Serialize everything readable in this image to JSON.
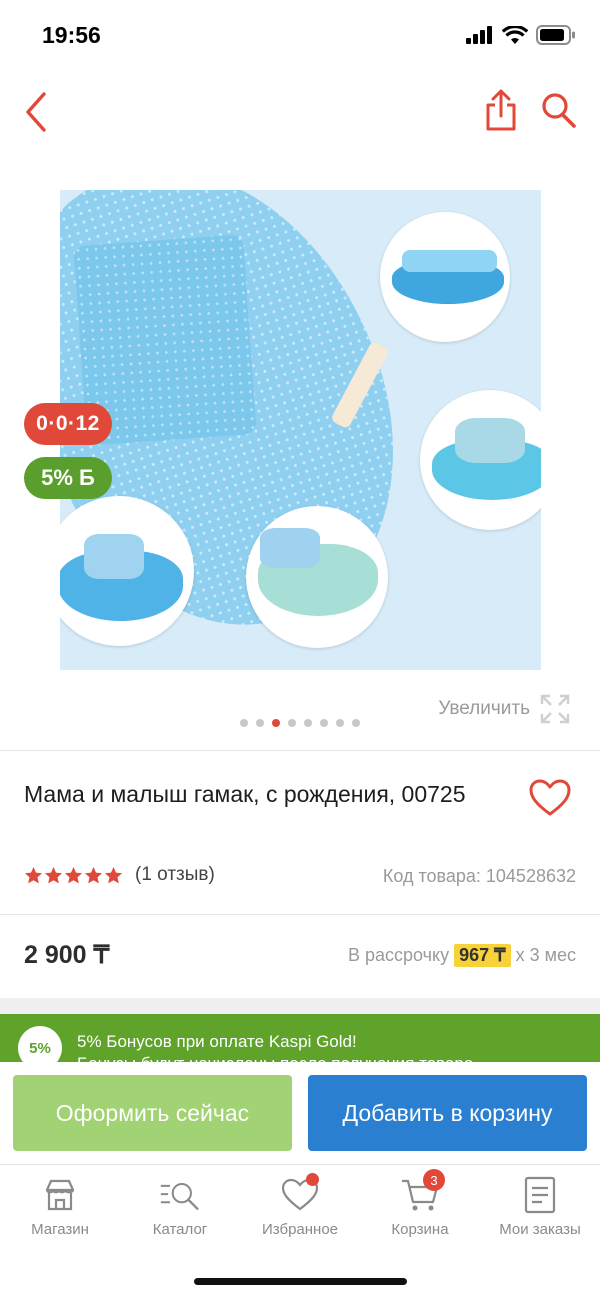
{
  "status_bar": {
    "time": "19:56"
  },
  "nav": {
    "back_icon": "chevron-left-icon",
    "share_icon": "share-icon",
    "search_icon": "search-icon"
  },
  "product": {
    "badge_installment": "0·0·12",
    "badge_bonus": "5% Б",
    "zoom_label": "Увеличить",
    "gallery": {
      "total": 8,
      "active_index": 2
    },
    "title": "Мама и малыш гамак, с рождения, 00725",
    "rating": {
      "stars": 5,
      "reviews": "(1 отзыв)"
    },
    "sku": "Код товара: 104528632",
    "price": "2 900 ₸",
    "installment": {
      "prefix": "В рассрочку",
      "amount": "967 ₸",
      "suffix": "х 3 мес"
    }
  },
  "bonus_banner": {
    "percent": "5%",
    "line1": "5% Бонусов при оплате Kaspi Gold!",
    "line2": "Бонусы будут начислены после получения товара"
  },
  "actions": {
    "buy_now": "Оформить сейчас",
    "add_to_cart": "Добавить в корзину"
  },
  "tab_bar": {
    "items": [
      {
        "label": "Магазин",
        "icon": "store-icon"
      },
      {
        "label": "Каталог",
        "icon": "catalog-search-icon"
      },
      {
        "label": "Избранное",
        "icon": "heart-icon"
      },
      {
        "label": "Корзина",
        "icon": "cart-icon",
        "badge": "3"
      },
      {
        "label": "Мои заказы",
        "icon": "orders-icon"
      }
    ]
  },
  "colors": {
    "accent": "#e0483a",
    "buy": "#a1d273",
    "cart": "#2b7fd1",
    "bonus": "#5fa32a",
    "highlight": "#f7d238"
  }
}
